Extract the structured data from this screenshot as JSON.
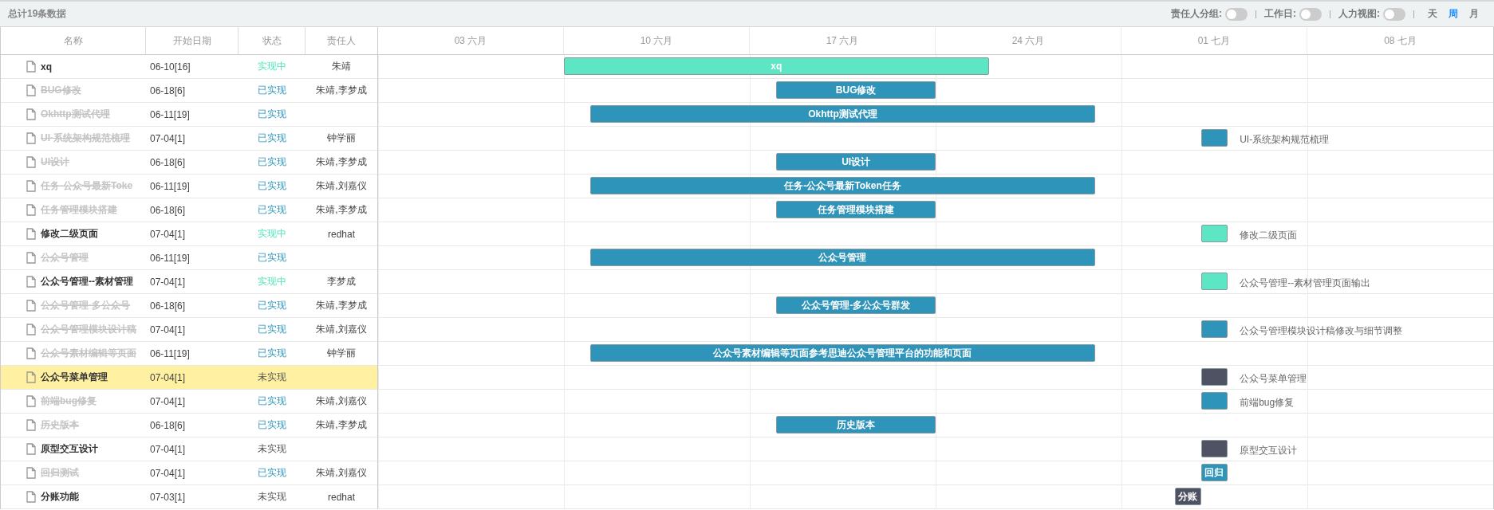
{
  "toolbar": {
    "total": "总计19条数据",
    "toggles": [
      {
        "label": "责任人分组:",
        "on": false
      },
      {
        "label": "工作日:",
        "on": false
      },
      {
        "label": "人力视图:",
        "on": false
      }
    ],
    "scales": [
      {
        "label": "天",
        "selected": false
      },
      {
        "label": "周",
        "selected": true
      },
      {
        "label": "月",
        "selected": false
      }
    ]
  },
  "table": {
    "columns": [
      "名称",
      "开始日期",
      "状态",
      "责任人"
    ],
    "rows": [
      {
        "name": "xq",
        "done": false,
        "start": "06-10[16]",
        "status": "实现中",
        "kind": "doing",
        "owner": "朱靖",
        "selected": false,
        "bar": {
          "label": "xq",
          "inside": true,
          "color": "#5ce6c4"
        }
      },
      {
        "name": "BUG修改",
        "done": true,
        "start": "06-18[6]",
        "status": "已实现",
        "kind": "done",
        "owner": "朱靖,李梦成",
        "selected": false,
        "bar": {
          "label": "BUG修改",
          "inside": true,
          "color": "#2e94b9"
        }
      },
      {
        "name": "Okhttp测试代理",
        "done": true,
        "start": "06-11[19]",
        "status": "已实现",
        "kind": "done",
        "selected": false,
        "bar": {
          "label": "Okhttp测试代理",
          "inside": true,
          "color": "#2e94b9"
        }
      },
      {
        "name": "UI-系统架构规范梳理",
        "done": true,
        "start": "07-04[1]",
        "status": "已实现",
        "kind": "done",
        "owner": "钟学丽",
        "selected": false,
        "bar": {
          "label": "UI-系统架构规范梳理",
          "inside": false,
          "color": "#2e94b9"
        }
      },
      {
        "name": "UI设计",
        "done": true,
        "start": "06-18[6]",
        "status": "已实现",
        "kind": "done",
        "owner": "朱靖,李梦成",
        "selected": false,
        "bar": {
          "label": "UI设计",
          "inside": true,
          "color": "#2e94b9"
        }
      },
      {
        "name": "任务-公众号最新Toke",
        "done": true,
        "start": "06-11[19]",
        "status": "已实现",
        "kind": "done",
        "owner": "朱靖,刘嘉仪",
        "selected": false,
        "bar": {
          "label": "任务-公众号最新Token任务",
          "inside": true,
          "color": "#2e94b9"
        }
      },
      {
        "name": "任务管理模块搭建",
        "done": true,
        "start": "06-18[6]",
        "status": "已实现",
        "kind": "done",
        "owner": "朱靖,李梦成",
        "selected": false,
        "bar": {
          "label": "任务管理模块搭建",
          "inside": true,
          "color": "#2e94b9"
        }
      },
      {
        "name": "修改二级页面",
        "done": false,
        "start": "07-04[1]",
        "status": "实现中",
        "kind": "doing",
        "owner": "redhat",
        "selected": false,
        "bar": {
          "label": "修改二级页面",
          "inside": false,
          "color": "#5ce6c4"
        }
      },
      {
        "name": "公众号管理",
        "done": true,
        "start": "06-11[19]",
        "status": "已实现",
        "kind": "done",
        "selected": false,
        "bar": {
          "label": "公众号管理",
          "inside": true,
          "color": "#2e94b9"
        }
      },
      {
        "name": "公众号管理--素材管理",
        "done": false,
        "start": "07-04[1]",
        "status": "实现中",
        "kind": "doing",
        "owner": "李梦成",
        "selected": false,
        "bar": {
          "label": "公众号管理--素材管理页面输出",
          "inside": false,
          "color": "#5ce6c4"
        }
      },
      {
        "name": "公众号管理-多公众号",
        "done": true,
        "start": "06-18[6]",
        "status": "已实现",
        "kind": "done",
        "owner": "朱靖,李梦成",
        "selected": false,
        "bar": {
          "label": "公众号管理-多公众号群发",
          "inside": true,
          "color": "#2e94b9"
        }
      },
      {
        "name": "公众号管理模块设计稿",
        "done": true,
        "start": "07-04[1]",
        "status": "已实现",
        "kind": "done",
        "owner": "朱靖,刘嘉仪",
        "selected": false,
        "bar": {
          "label": "公众号管理模块设计稿修改与细节调整",
          "inside": false,
          "color": "#2e94b9"
        }
      },
      {
        "name": "公众号素材编辑等页面",
        "done": true,
        "start": "06-11[19]",
        "status": "已实现",
        "kind": "done",
        "owner": "钟学丽",
        "selected": false,
        "bar": {
          "label": "公众号素材编辑等页面参考思迪公众号管理平台的功能和页面",
          "inside": true,
          "color": "#2e94b9"
        }
      },
      {
        "name": "公众号菜单管理",
        "done": false,
        "start": "07-04[1]",
        "status": "未实现",
        "kind": "todo",
        "selected": true,
        "bar": {
          "label": "公众号菜单管理",
          "inside": false,
          "color": "#4e5263"
        }
      },
      {
        "name": "前端bug修复",
        "done": true,
        "start": "07-04[1]",
        "status": "已实现",
        "kind": "done",
        "owner": "朱靖,刘嘉仪",
        "selected": false,
        "bar": {
          "label": "前端bug修复",
          "inside": false,
          "color": "#2e94b9"
        }
      },
      {
        "name": "历史版本",
        "done": true,
        "start": "06-18[6]",
        "status": "已实现",
        "kind": "done",
        "owner": "朱靖,李梦成",
        "selected": false,
        "bar": {
          "label": "历史版本",
          "inside": true,
          "color": "#2e94b9"
        }
      },
      {
        "name": "原型交互设计",
        "done": false,
        "start": "07-04[1]",
        "status": "未实现",
        "kind": "todo",
        "selected": false,
        "bar": {
          "label": "原型交互设计",
          "inside": false,
          "color": "#4e5263"
        }
      },
      {
        "name": "回归测试",
        "done": true,
        "start": "07-04[1]",
        "status": "已实现",
        "kind": "done",
        "owner": "朱靖,刘嘉仪",
        "selected": false,
        "bar": {
          "label": "回归",
          "inside": true,
          "color": "#2e94b9"
        }
      },
      {
        "name": "分账功能",
        "done": false,
        "start": "07-03[1]",
        "status": "未实现",
        "kind": "todo",
        "owner": "redhat",
        "selected": false,
        "bar": {
          "label": "分账",
          "inside": true,
          "color": "#4e5263"
        }
      }
    ]
  },
  "timeline": {
    "weeks": [
      "03 六月",
      "10 六月",
      "17 六月",
      "24 六月",
      "01 七月",
      "08 七月"
    ]
  }
}
